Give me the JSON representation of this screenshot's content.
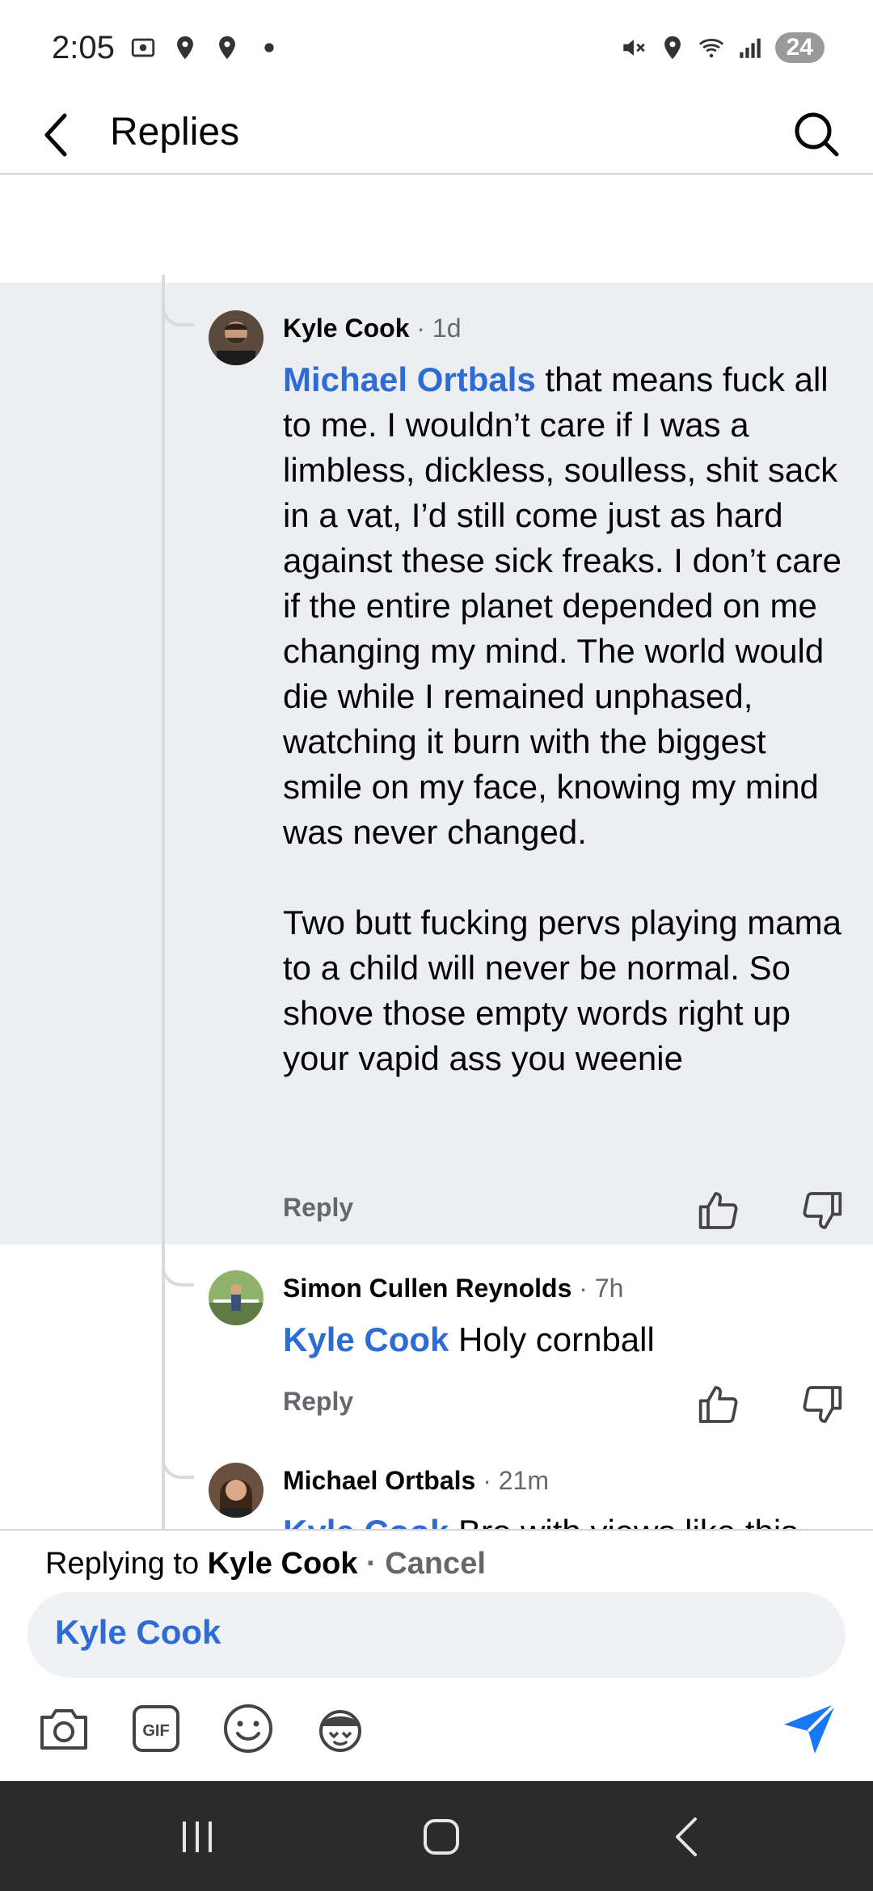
{
  "status_bar": {
    "time": "2:05",
    "battery": "24"
  },
  "header": {
    "title": "Replies"
  },
  "comments": [
    {
      "author": "Kyle Cook",
      "time": "· 1d",
      "mention": "Michael Ortbals",
      "text_p1": " that means fuck all to me. I wouldn’t care if I was a limbless, dickless, soulless, shit sack in a vat, I’d still come just as hard against these sick freaks. I don’t care if the entire planet depended on me changing my mind. The world would die while I remained unphased, watching it burn with the biggest smile on my face, knowing my mind was never changed.",
      "text_p2": "Two butt fucking pervs playing mama to a child will never be normal. So shove those empty words right up your vapid ass you weenie",
      "reply_label": "Reply"
    },
    {
      "author": "Simon Cullen Reynolds",
      "time": "· 7h",
      "mention": "Kyle Cook",
      "text": " Holy cornball",
      "reply_label": "Reply"
    },
    {
      "author": "Michael Ortbals",
      "time": "· 21m",
      "mention": "Kyle Cook",
      "text": " Bro with views like this"
    }
  ],
  "reply_bar": {
    "prefix": "Replying to ",
    "name": "Kyle Cook",
    "cancel": " · Cancel",
    "composer_text": "Kyle Cook"
  },
  "icons": {
    "back": "back-arrow-icon",
    "search": "search-icon",
    "like": "thumbs-up-icon",
    "dislike": "thumbs-down-icon",
    "camera": "camera-icon",
    "gif": "gif-icon",
    "emoji": "emoji-icon",
    "avatar_sticker": "avatar-sticker-icon",
    "send": "send-icon"
  },
  "colors": {
    "accent": "#2d6bd5",
    "highlight": "#eceef2",
    "nav_bar": "#2b2b2b"
  }
}
